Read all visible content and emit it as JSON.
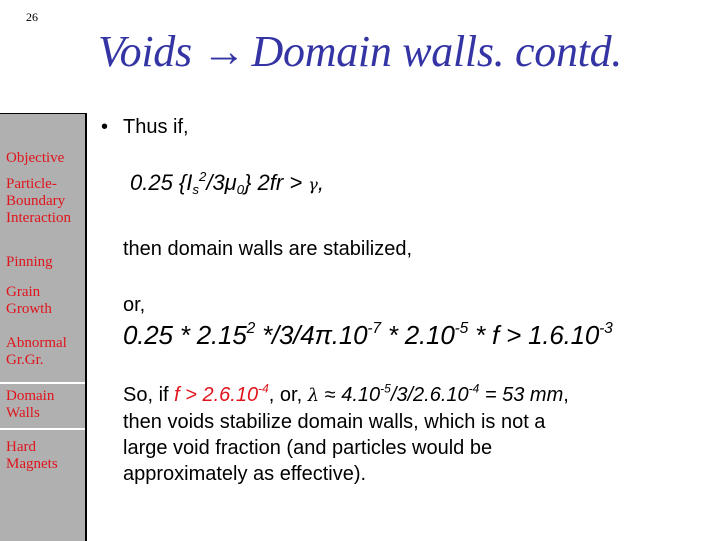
{
  "slide": {
    "page_number": "26",
    "title": {
      "left": "Voids",
      "arrow": "→",
      "right": "Domain walls. contd."
    }
  },
  "sidebar": {
    "items": [
      {
        "label_lines": [
          "Objective"
        ],
        "active": false
      },
      {
        "label_lines": [
          "Particle-",
          "Boundary",
          "Interaction"
        ],
        "active": false
      },
      {
        "label_lines": [
          "Pinning"
        ],
        "active": false
      },
      {
        "label_lines": [
          "Grain",
          "Growth"
        ],
        "active": false
      },
      {
        "label_lines": [
          "Abnormal",
          "Gr.Gr."
        ],
        "active": false
      },
      {
        "label_lines": [
          "Domain",
          "Walls"
        ],
        "active": true
      },
      {
        "label_lines": [
          "Hard",
          "Magnets"
        ],
        "active": false
      }
    ],
    "colors": {
      "background": "#b0b0b0",
      "text": "#e0141c",
      "border": "#000000",
      "active_border": "#ffffff"
    }
  },
  "content": {
    "bullet": "•",
    "bullet_text": "Thus if,",
    "formula1": {
      "prefix": "0.25 {I",
      "sub_s": "s",
      "sup_2": "2",
      "mid": "/3μ",
      "sub_0": "0",
      "suffix": "} 2fr > ",
      "gamma": "γ",
      "end": ","
    },
    "then_text": "then domain walls are stabilized,",
    "or_text": "or,",
    "formula2": {
      "a": "0.25 * 2.15",
      "a_sup": "2",
      "b": " */3/4π.10",
      "b_sup": "-7",
      "c": " * 2.10",
      "c_sup": "-5",
      "d": " * f > 1.6.10",
      "d_sup": "-3"
    },
    "paragraph": {
      "line1": {
        "t1": "So, if ",
        "hl": "f > 2.6.10",
        "hl_sup": "-4",
        "t2": ", or, ",
        "lambda": "λ",
        "t3": " ≈ ",
        "it1": "4.10",
        "it1_sup": "-5",
        "it2": "/3/2.6.10",
        "it2_sup": "-4",
        "it3": " = 53 mm",
        "t4": ","
      },
      "line2": "then voids stabilize domain walls, which is not a",
      "line3": "large void fraction (and particles would be",
      "line4": "approximately as effective)."
    },
    "colors": {
      "title": "#3434a4",
      "highlight": "#e0141c",
      "text": "#000000"
    }
  }
}
